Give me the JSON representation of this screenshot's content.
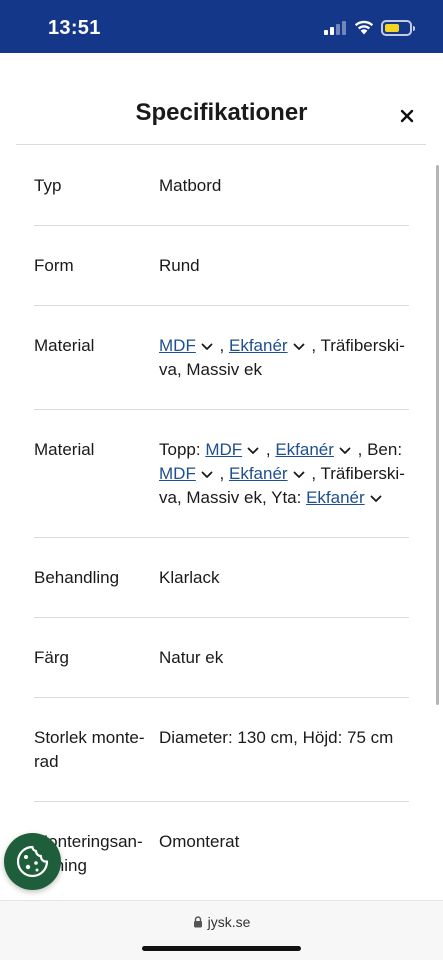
{
  "status_bar": {
    "time": "13:51",
    "battery_level": 0.6,
    "battery_color": "#f5d523"
  },
  "modal": {
    "title": "Specifikationer",
    "close_icon": "close-icon"
  },
  "specs": [
    {
      "label": "Typ",
      "value": "Matbord"
    },
    {
      "label": "Form",
      "value": "Rund"
    },
    {
      "label": "Material",
      "parts": [
        {
          "link": "MDF"
        },
        {
          "text": " , "
        },
        {
          "link": "Ekfanér"
        },
        {
          "text": " , Träfiberski­va, Massiv ek"
        }
      ]
    },
    {
      "label": "Material",
      "parts": [
        {
          "text": "Topp: "
        },
        {
          "link": "MDF"
        },
        {
          "text": " , "
        },
        {
          "link": "Ekfanér"
        },
        {
          "text": " , Ben: "
        },
        {
          "link": "MDF"
        },
        {
          "text": " , "
        },
        {
          "link": "Ekfanér"
        },
        {
          "text": " , Träfiberski­va, Massiv ek, Yta: "
        },
        {
          "link": "Ekfanér"
        }
      ]
    },
    {
      "label": "Behandling",
      "value": "Klarlack"
    },
    {
      "label": "Färg",
      "value": "Natur ek"
    },
    {
      "label": "Storlek monte­rad",
      "value": "Diameter: 130 cm, Höjd: 75 cm"
    },
    {
      "label": "Monteringsan­visning",
      "value": "Omonterat"
    }
  ],
  "browser": {
    "url": "jysk.se"
  },
  "colors": {
    "status_bar": "#14378a",
    "link": "#1d4f91",
    "cookie_button": "#1f5e3b"
  }
}
